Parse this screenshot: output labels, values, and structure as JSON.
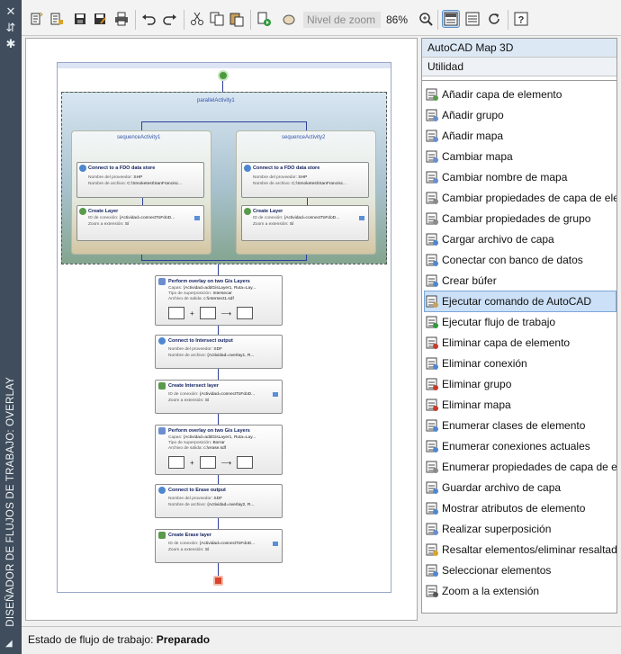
{
  "sidebar": {
    "title": "DISEÑADOR DE FLUJOS DE TRABAJO: OVERLAY",
    "top_icons": [
      "close-icon",
      "pin-icon",
      "settings-icon"
    ]
  },
  "toolbar": {
    "zoom_placeholder": "Nivel de zoom",
    "zoom_value": "86%"
  },
  "panel": {
    "header": "AutoCAD Map 3D",
    "subheader": "Utilidad",
    "items": [
      "Añadir capa de elemento",
      "Añadir grupo",
      "Añadir mapa",
      "Cambiar mapa",
      "Cambiar nombre de mapa",
      "Cambiar propiedades de capa de ele",
      "Cambiar propiedades de grupo",
      "Cargar archivo de capa",
      "Conectar con banco de datos",
      "Crear búfer",
      "Ejecutar comando de AutoCAD",
      "Ejecutar flujo de trabajo",
      "Eliminar capa de elemento",
      "Eliminar conexión",
      "Eliminar grupo",
      "Eliminar mapa",
      "Enumerar clases de elemento",
      "Enumerar conexiones actuales",
      "Enumerar propiedades de capa de el",
      "Guardar archivo de capa",
      "Mostrar atributos de elemento",
      "Realizar superposición",
      "Resaltar elementos/eliminar resaltad",
      "Seleccionar elementos",
      "Zoom a la extensión"
    ],
    "selected_item": "Ejecutar comando de AutoCAD"
  },
  "workflow": {
    "parallel_label": "parallelActivity1",
    "seq1_label": "sequenceActivity1",
    "seq2_label": "sequenceActivity2",
    "seq1": {
      "connect_title": "Connect to a FDO data store",
      "connect_k1": "Nombre del proveedor:",
      "connect_v1": "SHP",
      "connect_k2": "Nombre de archivo:",
      "connect_v2": "C:\\Smoketest\\SanFrancisc...",
      "layer_title": "Create Layer",
      "layer_k1": "ID de conexión:",
      "layer_v1": "{Actividad=connectToFdoD...",
      "layer_k2": "Zoom a extensión:",
      "layer_v2": "Sí"
    },
    "seq2": {
      "connect_title": "Connect to a FDO data store",
      "connect_k1": "Nombre del proveedor:",
      "connect_v1": "SHP",
      "connect_k2": "Nombre de archivo:",
      "connect_v2": "C:\\Smoketest\\SanFrancisc...",
      "layer_title": "Create Layer",
      "layer_k1": "ID de conexión:",
      "layer_v1": "{Actividad=connectToFdoD...",
      "layer_k2": "Zoom a extensión:",
      "layer_v2": "Sí"
    },
    "overlay1": {
      "title": "Perform overlay on two Gis Layers",
      "k1": "Capas:",
      "v1": "{Actividad=addGisLayer1, Ruta=Lay...",
      "k2": "Tipo de superposición:",
      "v2": "Intersecar",
      "k3": "Archivo de salida:",
      "v3": "c:\\intersect1.sdf"
    },
    "connect_intersect": {
      "title": "Connect to Intersect output",
      "k1": "Nombre del proveedor:",
      "v1": "SDF",
      "k2": "Nombre de archivo:",
      "v2": "{Actividad=overlay1, R..."
    },
    "create_intersect": {
      "title": "Create Intersect layer",
      "k1": "ID de conexión:",
      "v1": "{Actividad=connectToFdoD...",
      "k2": "Zoom a extensión:",
      "v2": "Sí"
    },
    "overlay2": {
      "title": "Perform overlay on two Gis Layers",
      "k1": "Capas:",
      "v1": "{Actividad=addGisLayer1, Ruta=Lay...",
      "k2": "Tipo de superposición:",
      "v2": "Borrar",
      "k3": "Archivo de salida:",
      "v3": "c:\\erase.sdf"
    },
    "connect_erase": {
      "title": "Connect to Erase output",
      "k1": "Nombre del proveedor:",
      "v1": "SDF",
      "k2": "Nombre de archivo:",
      "v2": "{Actividad=overlay2, R..."
    },
    "create_erase": {
      "title": "Create Erase layer",
      "k1": "ID de conexión:",
      "v1": "{Actividad=connectToFdoD...",
      "k2": "Zoom a extensión:",
      "v2": "Sí"
    }
  },
  "status": {
    "label": "Estado de flujo de trabajo:",
    "value": "Preparado"
  }
}
